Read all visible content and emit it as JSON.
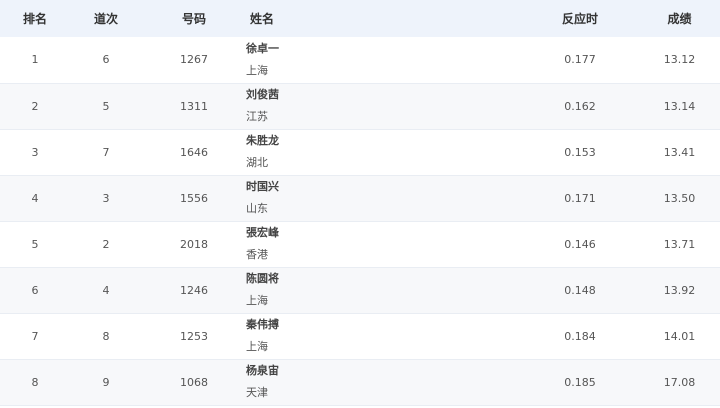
{
  "headers": {
    "rank": "排名",
    "lane": "道次",
    "bib": "号码",
    "name": "姓名",
    "reaction": "反应时",
    "result": "成绩"
  },
  "rows": [
    {
      "rank": "1",
      "lane": "6",
      "bib": "1267",
      "name": "徐卓一",
      "team": "上海",
      "reaction": "0.177",
      "result": "13.12"
    },
    {
      "rank": "2",
      "lane": "5",
      "bib": "1311",
      "name": "刘俊茜",
      "team": "江苏",
      "reaction": "0.162",
      "result": "13.14"
    },
    {
      "rank": "3",
      "lane": "7",
      "bib": "1646",
      "name": "朱胜龙",
      "team": "湖北",
      "reaction": "0.153",
      "result": "13.41"
    },
    {
      "rank": "4",
      "lane": "3",
      "bib": "1556",
      "name": "时国兴",
      "team": "山东",
      "reaction": "0.171",
      "result": "13.50"
    },
    {
      "rank": "5",
      "lane": "2",
      "bib": "2018",
      "name": "張宏峰",
      "team": "香港",
      "reaction": "0.146",
      "result": "13.71"
    },
    {
      "rank": "6",
      "lane": "4",
      "bib": "1246",
      "name": "陈圆将",
      "team": "上海",
      "reaction": "0.148",
      "result": "13.92"
    },
    {
      "rank": "7",
      "lane": "8",
      "bib": "1253",
      "name": "秦伟搏",
      "team": "上海",
      "reaction": "0.184",
      "result": "14.01"
    },
    {
      "rank": "8",
      "lane": "9",
      "bib": "1068",
      "name": "杨泉宙",
      "team": "天津",
      "reaction": "0.185",
      "result": "17.08"
    }
  ]
}
